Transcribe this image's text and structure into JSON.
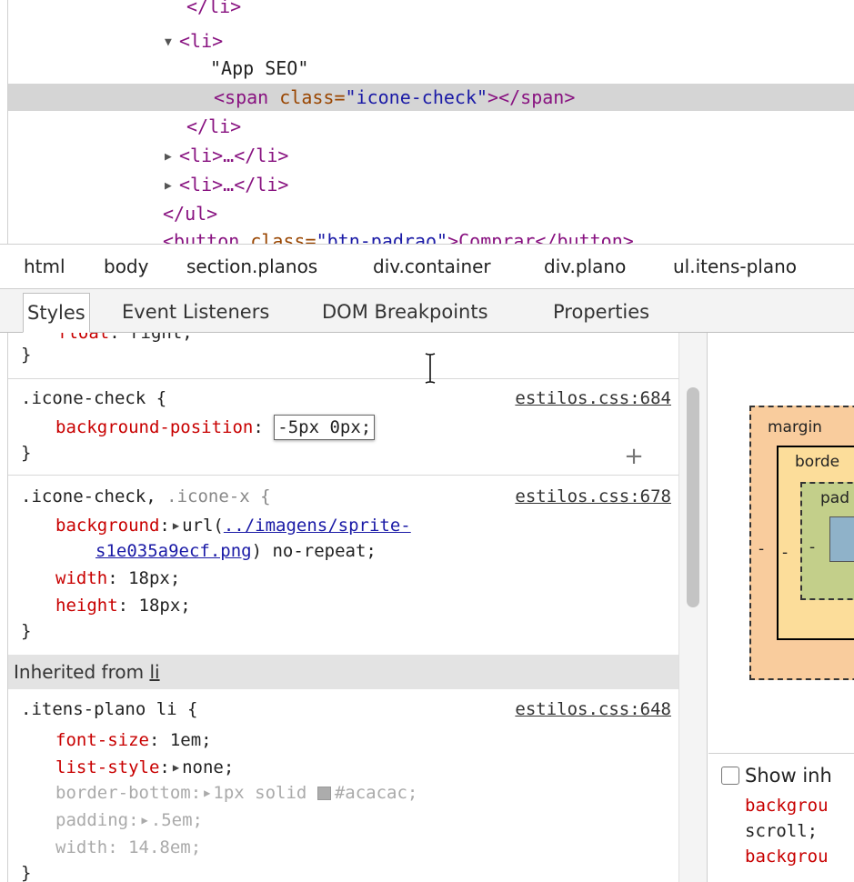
{
  "dom_tree": {
    "lines": [
      {
        "arrow": "",
        "open": "</li>",
        "text": "",
        "attr_name": "",
        "attr_val": "",
        "close": ""
      },
      {
        "arrow": "▼",
        "open": "<li>",
        "text": "",
        "attr_name": "",
        "attr_val": "",
        "close": ""
      },
      {
        "arrow": "",
        "open": "",
        "text": "\"App SEO\"",
        "attr_name": "",
        "attr_val": "",
        "close": ""
      },
      {
        "arrow": "",
        "open": "<span ",
        "text": "",
        "attr_name": "class=",
        "attr_val": "\"icone-check\"",
        "close": "></span>"
      },
      {
        "arrow": "",
        "open": "</li>",
        "text": "",
        "attr_name": "",
        "attr_val": "",
        "close": ""
      },
      {
        "arrow": "▶",
        "open": "<li>…</li>",
        "text": "",
        "attr_name": "",
        "attr_val": "",
        "close": ""
      },
      {
        "arrow": "▶",
        "open": "<li>…</li>",
        "text": "",
        "attr_name": "",
        "attr_val": "",
        "close": ""
      },
      {
        "arrow": "",
        "open": "</ul>",
        "text": "",
        "attr_name": "",
        "attr_val": "",
        "close": ""
      },
      {
        "arrow": "",
        "open": "<button ",
        "text": "",
        "attr_name": "class=",
        "attr_val": "\"btn-padrao\"",
        "close": ">Comprar</button>"
      }
    ]
  },
  "breadcrumb": [
    "html",
    "body",
    "section.planos",
    "div.container",
    "div.plano",
    "ul.itens-plano"
  ],
  "tabs": [
    {
      "label": "Styles",
      "active": true
    },
    {
      "label": "Event Listeners",
      "active": false
    },
    {
      "label": "DOM Breakpoints",
      "active": false
    },
    {
      "label": "Properties",
      "active": false
    }
  ],
  "styles": {
    "partial_top": {
      "prop": "float",
      "val": "right;"
    },
    "close_brace": "}",
    "rule1": {
      "selector": ".icone-check {",
      "source": "estilos.css:684",
      "prop": "background-position",
      "colon": ":",
      "editing_value": "-5px 0px",
      "semicolon": ";"
    },
    "rule2": {
      "selector_main": ".icone-check,",
      "selector_dim": ".icone-x {",
      "source": "estilos.css:678",
      "bg_prop": "background",
      "bg_url_prefix": "url(",
      "bg_url_part1": "../imagens/sprite-",
      "bg_url_part2": "s1e035a9ecf.png",
      "bg_suffix": ") no-repeat;",
      "width_prop": "width",
      "width_val": "18px;",
      "height_prop": "height",
      "height_val": "18px;"
    },
    "inherited_label": "Inherited from",
    "inherited_from": "li",
    "rule3": {
      "selector": ".itens-plano li {",
      "source": "estilos.css:648",
      "font_size_prop": "font-size",
      "font_size_val": "1em;",
      "list_style_prop": "list-style",
      "list_style_val": "none;",
      "border_bottom_prop": "border-bottom",
      "border_bottom_val_a": "1px solid",
      "border_bottom_color": "#acacac;",
      "padding_prop": "padding",
      "padding_val": ".5em;",
      "width_prop": "width",
      "width_val": "14.8em;"
    },
    "add_rule_icon": "+"
  },
  "box_model": {
    "margin_label": "margin",
    "border_label": "borde",
    "padding_label": "pad",
    "dash": "-"
  },
  "computed": {
    "show_inherited": "Show inh",
    "lines": [
      "backgrou",
      "scroll;",
      "backgrou"
    ]
  },
  "colors": {
    "tag": "#881280",
    "attr_name": "#994500",
    "attr_value": "#1a1aa6",
    "css_property": "#c80000",
    "selected_row": "#d5d5d5",
    "margin_box": "#f9cc9d",
    "border_box": "#fcdd9a",
    "padding_box": "#c3cf8a",
    "content_box": "#8fb2c9"
  }
}
